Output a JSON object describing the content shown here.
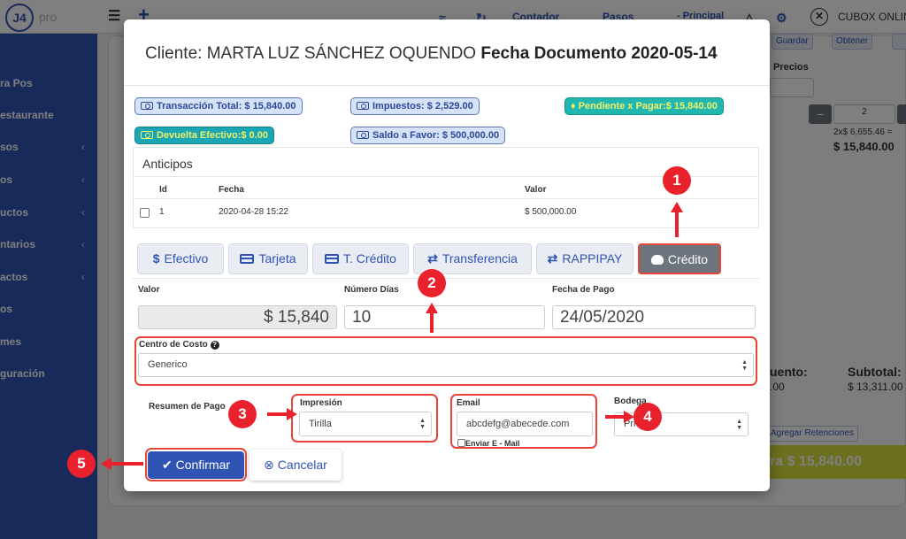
{
  "background": {
    "logo_text": "J4",
    "logo_suffix": "pro",
    "sidebar_items": [
      "ra Pos",
      "estaurante",
      "sos",
      "os",
      "uctos",
      "ntarios",
      "actos",
      "os",
      "mes",
      "guración"
    ],
    "topbar": {
      "contador": "Contador",
      "pasos": "Pasos",
      "principal": "- Principal",
      "company": "CUBOX ONLINE"
    },
    "panel": {
      "guardar": "Guardar",
      "obtener": "Obtener",
      "precios_label": "Precios",
      "qty_value": "2",
      "unit_price": "2x$ 6,655.46 =",
      "line_total": "$ 15,840.00",
      "descuento_label": "uento:",
      "descuento_value": ".00",
      "subtotal_label": "Subtotal:",
      "subtotal_value": "$ 13,311.00",
      "retenciones": "Agregar Retenciones",
      "pay_label": "ra $ 15,840.00"
    }
  },
  "modal": {
    "client_label": "Cliente: MARTA LUZ SÁNCHEZ OQUENDO",
    "doc_date_label": "Fecha Documento 2020-05-14",
    "badges": {
      "transaccion_total": "Transacción Total: $ 15,840.00",
      "impuestos": "Impuestos: $ 2,529.00",
      "pendiente": "Pendiente x Pagar:$ 15,840.00",
      "devuelta": "Devuelta Efectivo:$ 0.00",
      "saldo_favor": "Saldo a Favor: $ 500,000.00"
    },
    "anticipos": {
      "title": "Anticipos",
      "headers": [
        "Id",
        "Fecha",
        "Valor"
      ],
      "rows": [
        {
          "id": "1",
          "fecha": "2020-04-28 15:22",
          "valor": "$ 500,000.00"
        }
      ]
    },
    "tabs": [
      "Efectivo",
      "Tarjeta",
      "T. Crédito",
      "Transferencia",
      "RAPPIPAY",
      "Crédito"
    ],
    "fields": {
      "valor_label": "Valor",
      "valor_value": "$ 15,840",
      "dias_label": "Número Días",
      "dias_value": "10",
      "fecha_pago_label": "Fecha de Pago",
      "fecha_pago_value": "24/05/2020",
      "centro_costo_label": "Centro de Costo",
      "centro_costo_value": "Generico",
      "resumen_label": "Resumen de Pago",
      "impresion_label": "Impresión",
      "impresion_value": "Tirilla",
      "email_label": "Email",
      "email_value": "abcdefg@abecede.com",
      "enviar_label": "Enviar E - Mail",
      "bodega_label": "Bodega",
      "bodega_value": "Pri"
    },
    "buttons": {
      "confirmar": "Confirmar",
      "cancelar": "Cancelar"
    }
  },
  "annotations": [
    "1",
    "2",
    "3",
    "4",
    "5"
  ],
  "colors": {
    "brand_blue": "#2f54b4",
    "annotation_red": "#e8212c",
    "pending_badge": "#22b6b0"
  }
}
